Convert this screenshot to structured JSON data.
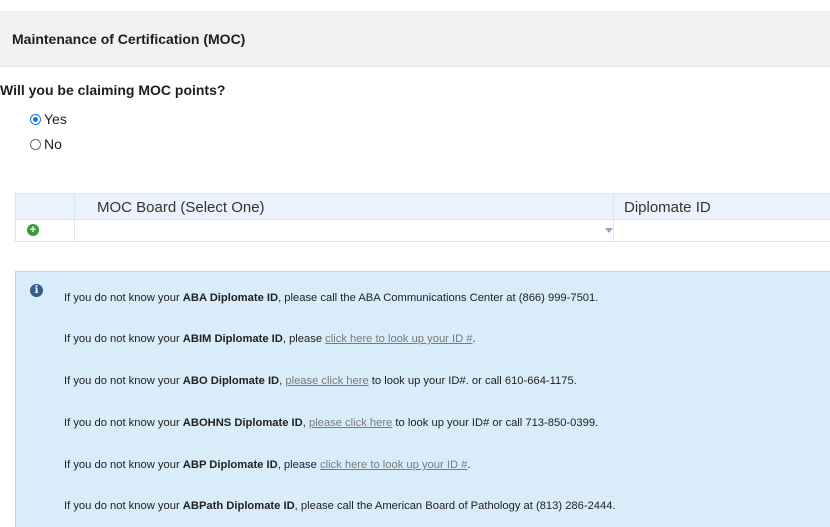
{
  "section": {
    "title": "Maintenance of Certification (MOC)"
  },
  "question": "Will you be claiming MOC points?",
  "options": [
    {
      "label": "Yes",
      "checked": true
    },
    {
      "label": "No",
      "checked": false
    }
  ],
  "grid": {
    "columns": [
      "MOC Board (Select One)",
      "Diplomate ID"
    ],
    "add_icon": "plus-circle-icon",
    "dropdown_icon": "chevron-down-icon"
  },
  "info": {
    "icon": "info-circle-icon",
    "lines": [
      {
        "prefix": "If you do not know your ",
        "bold": "ABA Diplomate ID",
        "middle": ", please call the ABA Communications Center at (866) 999-7501.",
        "link": "",
        "suffix": ""
      },
      {
        "prefix": "If you do not know your ",
        "bold": "ABIM Diplomate ID",
        "middle": ", please ",
        "link": "click here to look up your ID #",
        "suffix": "."
      },
      {
        "prefix": "If you do not know your ",
        "bold": "ABO Diplomate ID",
        "middle": ", ",
        "link": "please click here",
        "suffix": " to look up your ID#. or call 610-664-1175."
      },
      {
        "prefix": "If you do not know your ",
        "bold": "ABOHNS Diplomate ID",
        "middle": ", ",
        "link": "please click here",
        "suffix": " to look up your ID# or call 713-850-0399."
      },
      {
        "prefix": "If you do not know your ",
        "bold": "ABP Diplomate ID",
        "middle": ", please ",
        "link": "click here to look up your ID #",
        "suffix": "."
      },
      {
        "prefix": "If you do not know your ",
        "bold": "ABPath Diplomate ID",
        "middle": ", please call the American Board of Pathology at (813) 286-2444.",
        "link": "",
        "suffix": ""
      }
    ]
  },
  "colors": {
    "accent": "#1a73e8",
    "grid_header": "#eaf3fb",
    "info_bg": "#d9ecfa",
    "add_green": "#3d9b35"
  }
}
